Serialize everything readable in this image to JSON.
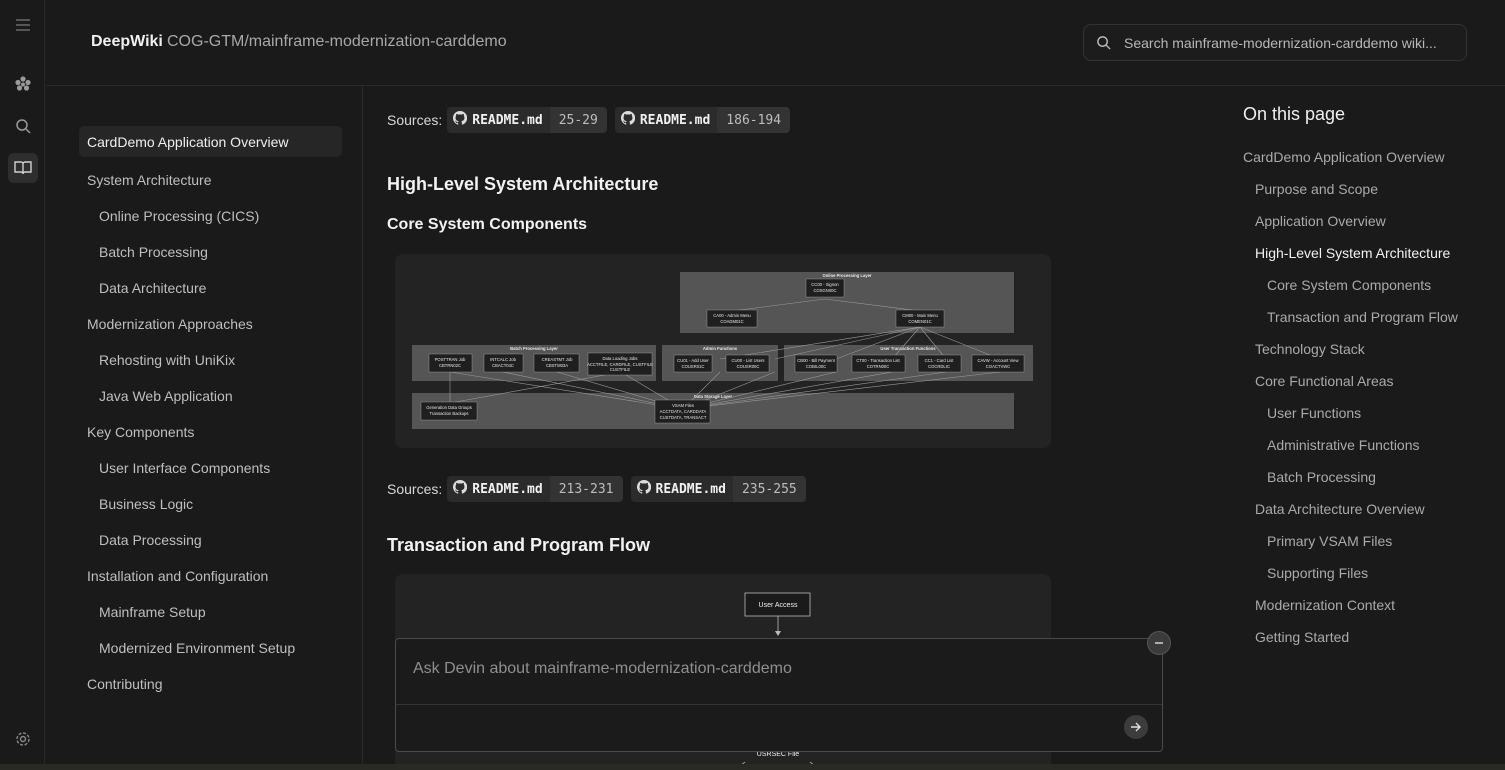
{
  "header": {
    "brand": "DeepWiki",
    "repo": "COG-GTM/mainframe-modernization-carddemo",
    "search_placeholder": "Search mainframe-modernization-carddemo wiki..."
  },
  "rail": {
    "icons": [
      "menu-icon",
      "devin-logo-icon",
      "search-icon",
      "book-icon",
      "settings-icon"
    ]
  },
  "nav": [
    {
      "label": "CardDemo Application Overview",
      "level": 1,
      "active": true
    },
    {
      "label": "System Architecture",
      "level": 1
    },
    {
      "label": "Online Processing (CICS)",
      "level": 2
    },
    {
      "label": "Batch Processing",
      "level": 2
    },
    {
      "label": "Data Architecture",
      "level": 2
    },
    {
      "label": "Modernization Approaches",
      "level": 1
    },
    {
      "label": "Rehosting with UniKix",
      "level": 2
    },
    {
      "label": "Java Web Application",
      "level": 2
    },
    {
      "label": "Key Components",
      "level": 1
    },
    {
      "label": "User Interface Components",
      "level": 2
    },
    {
      "label": "Business Logic",
      "level": 2
    },
    {
      "label": "Data Processing",
      "level": 2
    },
    {
      "label": "Installation and Configuration",
      "level": 1
    },
    {
      "label": "Mainframe Setup",
      "level": 2
    },
    {
      "label": "Modernized Environment Setup",
      "level": 2
    },
    {
      "label": "Contributing",
      "level": 1
    }
  ],
  "content": {
    "sources_label": "Sources:",
    "sources_top": [
      {
        "file": "README.md",
        "lines": "25-29"
      },
      {
        "file": "README.md",
        "lines": "186-194"
      }
    ],
    "h_arch": "High-Level System Architecture",
    "h_core": "Core System Components",
    "sources_mid": [
      {
        "file": "README.md",
        "lines": "213-231"
      },
      {
        "file": "README.md",
        "lines": "235-255"
      }
    ],
    "h_flow": "Transaction and Program Flow"
  },
  "diagram1": {
    "online_layer": "Online Processing Layer",
    "signon": [
      "CC00 - Signon",
      "COSGN00C"
    ],
    "admin_menu": [
      "CA00 - Admin Menu",
      "COADM01C"
    ],
    "main_menu": [
      "CM00 - Main Menu",
      "COMEN01C"
    ],
    "batch_layer": "Batch Processing Layer",
    "batch_jobs": [
      [
        "POSTTRAN Job",
        "CBTRN02C"
      ],
      [
        "INTCALC Job",
        "CBACT04C"
      ],
      [
        "CREASTMT Job",
        "CBSTM03A"
      ],
      [
        "Data Loading Jobs",
        "ACCTFILE, CARDFILE, CUSTFILE"
      ]
    ],
    "admin_layer": "Admin Functions",
    "admin_funcs": [
      [
        "CU01 - Add User",
        "COUSR01C"
      ],
      [
        "CU00 - List Users",
        "COUSR00C"
      ]
    ],
    "user_layer": "User Transaction Functions",
    "user_funcs": [
      [
        "CB00 - Bill Payment",
        "COBIL00C"
      ],
      [
        "CT00 - Transaction List",
        "COTRN00C"
      ],
      [
        "CC1 - Card List",
        "COCRDLIC"
      ],
      [
        "CAVW - Account View",
        "COACTVWC"
      ]
    ],
    "storage_layer": "Data Storage Layer",
    "gdg": [
      "Generation Data Groups",
      "Transaction Backups"
    ],
    "vsam": [
      "VSAM Files",
      "ACCTDATA, CARDDATA",
      "CUSTDATA, TRANSACT"
    ]
  },
  "diagram2": {
    "user_access": "User Access",
    "usrsec": "USRSEC File"
  },
  "ask": {
    "placeholder": "Ask Devin about mainframe-modernization-carddemo"
  },
  "toc": {
    "title": "On this page",
    "items": [
      {
        "label": "CardDemo Application Overview",
        "level": 1
      },
      {
        "label": "Purpose and Scope",
        "level": 2
      },
      {
        "label": "Application Overview",
        "level": 2
      },
      {
        "label": "High-Level System Architecture",
        "level": 2,
        "active": true
      },
      {
        "label": "Core System Components",
        "level": 3
      },
      {
        "label": "Transaction and Program Flow",
        "level": 3
      },
      {
        "label": "Technology Stack",
        "level": 2
      },
      {
        "label": "Core Functional Areas",
        "level": 2
      },
      {
        "label": "User Functions",
        "level": 3
      },
      {
        "label": "Administrative Functions",
        "level": 3
      },
      {
        "label": "Batch Processing",
        "level": 3
      },
      {
        "label": "Data Architecture Overview",
        "level": 2
      },
      {
        "label": "Primary VSAM Files",
        "level": 3
      },
      {
        "label": "Supporting Files",
        "level": 3
      },
      {
        "label": "Modernization Context",
        "level": 2
      },
      {
        "label": "Getting Started",
        "level": 2
      }
    ]
  },
  "colors": {
    "background": "#1a1a1a",
    "panel": "#232323",
    "text": "#d4d4d4",
    "muted": "#aaaaaa"
  }
}
